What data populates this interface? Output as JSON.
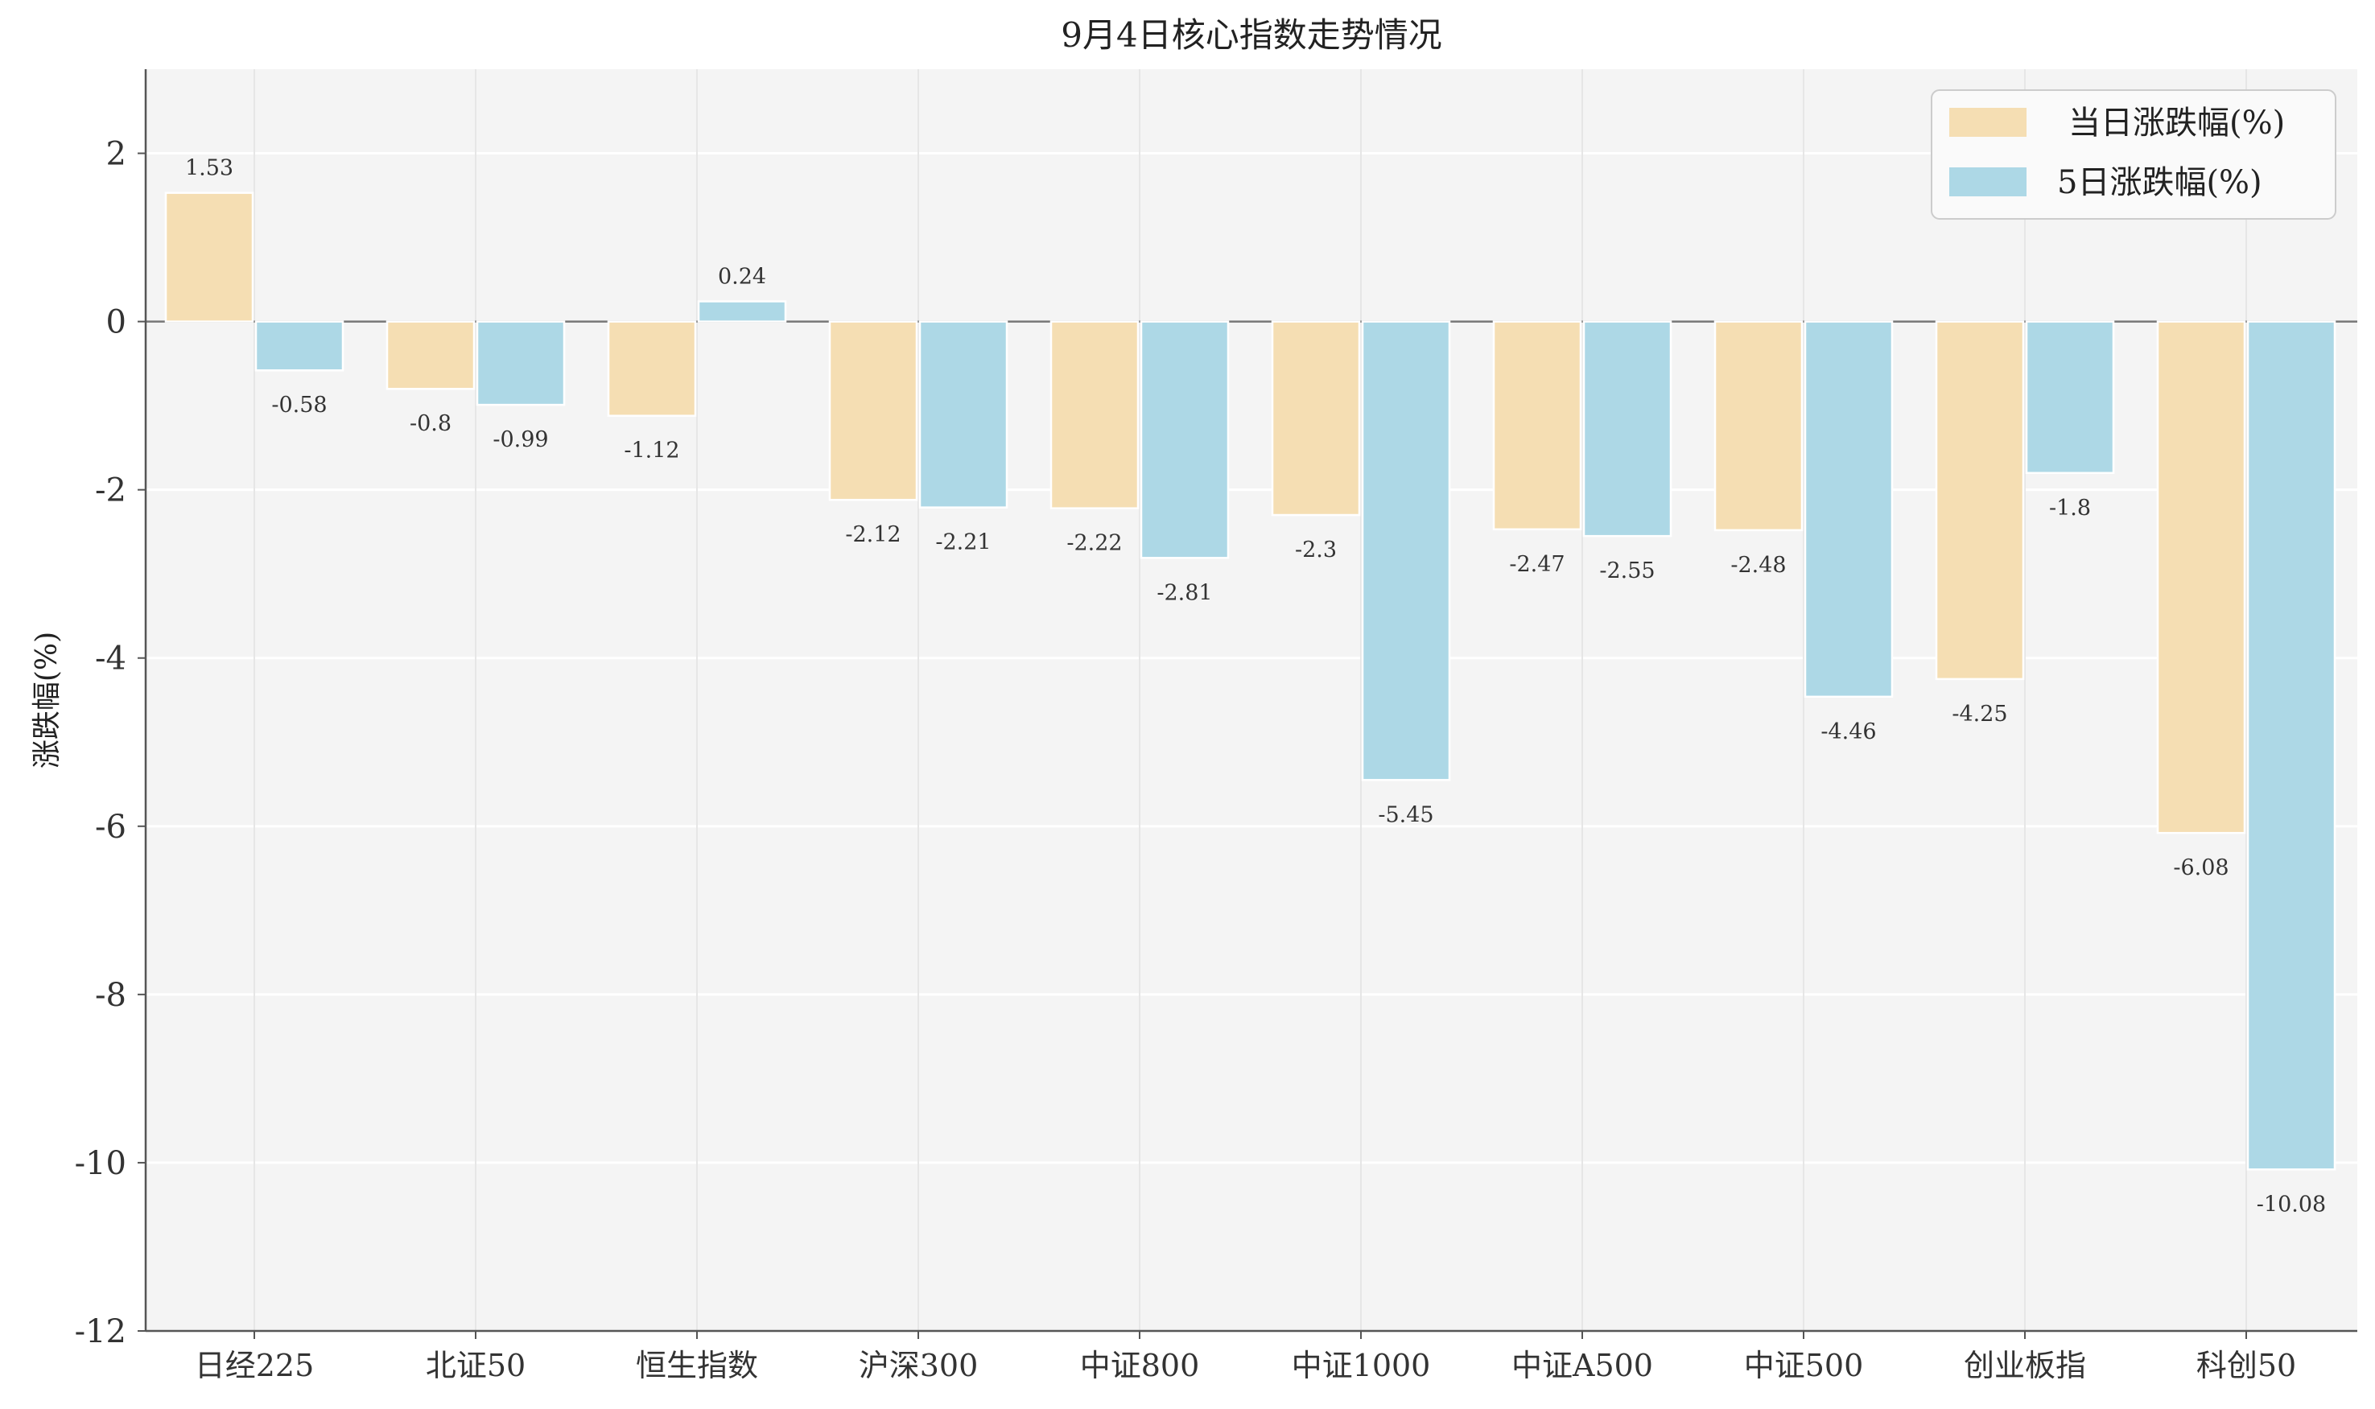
{
  "chart_data": {
    "type": "bar",
    "title": "9月4日核心指数走势情况",
    "xlabel": "",
    "ylabel": "涨跌幅(%)",
    "ylim": [
      -12,
      3
    ],
    "yticks": [
      2,
      0,
      -2,
      -4,
      -6,
      -8,
      -10,
      -12
    ],
    "grid": true,
    "legend_position": "top-right",
    "categories": [
      "日经225",
      "北证50",
      "恒生指数",
      "沪深300",
      "中证800",
      "中证1000",
      "中证A500",
      "中证500",
      "创业板指",
      "科创50"
    ],
    "series": [
      {
        "name": "当日涨跌幅(%)",
        "color": "#f5deb3",
        "values": [
          1.53,
          -0.8,
          -1.12,
          -2.12,
          -2.22,
          -2.3,
          -2.47,
          -2.48,
          -4.25,
          -6.08
        ],
        "labels": [
          "1.53",
          "-0.8",
          "-1.12",
          "-2.12",
          "-2.22",
          "-2.3",
          "-2.47",
          "-2.48",
          "-4.25",
          "-6.08"
        ]
      },
      {
        "name": "5日涨跌幅(%)",
        "color": "#add8e6",
        "values": [
          -0.58,
          -0.99,
          0.24,
          -2.21,
          -2.81,
          -5.45,
          -2.55,
          -4.46,
          -1.8,
          -10.08
        ],
        "labels": [
          "-0.58",
          "-0.99",
          "0.24",
          "-2.21",
          "-2.81",
          "-5.45",
          "-2.55",
          "-4.46",
          "-1.8",
          "-10.08"
        ]
      }
    ],
    "colors": {
      "plot_background": "#f4f4f4",
      "grid": "#ffffff",
      "axis": "#666666",
      "zero_line": "#777777"
    }
  }
}
